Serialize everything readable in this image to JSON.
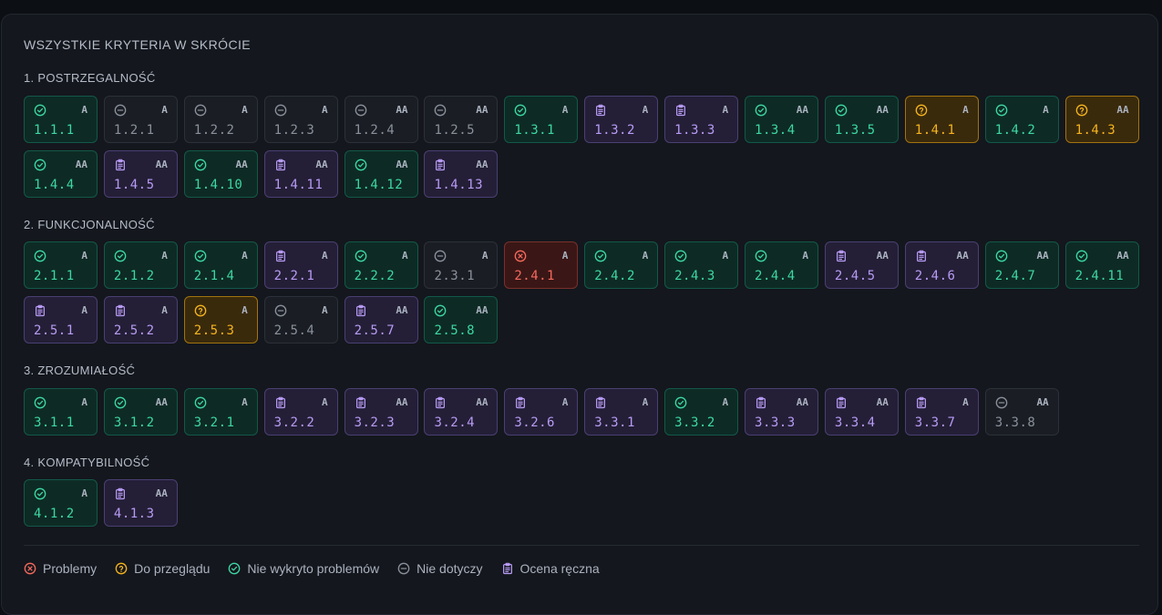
{
  "panel_title": "WSZYSTKIE KRYTERIA W SKRÓCIE",
  "sections": [
    {
      "title": "1. POSTRZEGALNOŚĆ",
      "items": [
        {
          "code": "1.1.1",
          "level": "A",
          "status": "pass"
        },
        {
          "code": "1.2.1",
          "level": "A",
          "status": "na"
        },
        {
          "code": "1.2.2",
          "level": "A",
          "status": "na"
        },
        {
          "code": "1.2.3",
          "level": "A",
          "status": "na"
        },
        {
          "code": "1.2.4",
          "level": "AA",
          "status": "na"
        },
        {
          "code": "1.2.5",
          "level": "AA",
          "status": "na"
        },
        {
          "code": "1.3.1",
          "level": "A",
          "status": "pass"
        },
        {
          "code": "1.3.2",
          "level": "A",
          "status": "manual"
        },
        {
          "code": "1.3.3",
          "level": "A",
          "status": "manual"
        },
        {
          "code": "1.3.4",
          "level": "AA",
          "status": "pass"
        },
        {
          "code": "1.3.5",
          "level": "AA",
          "status": "pass"
        },
        {
          "code": "1.4.1",
          "level": "A",
          "status": "review"
        },
        {
          "code": "1.4.2",
          "level": "A",
          "status": "pass"
        },
        {
          "code": "1.4.3",
          "level": "AA",
          "status": "review"
        },
        {
          "code": "1.4.4",
          "level": "AA",
          "status": "pass"
        },
        {
          "code": "1.4.5",
          "level": "AA",
          "status": "manual"
        },
        {
          "code": "1.4.10",
          "level": "AA",
          "status": "pass"
        },
        {
          "code": "1.4.11",
          "level": "AA",
          "status": "manual"
        },
        {
          "code": "1.4.12",
          "level": "AA",
          "status": "pass"
        },
        {
          "code": "1.4.13",
          "level": "AA",
          "status": "manual"
        }
      ]
    },
    {
      "title": "2. FUNKCJONALNOŚĆ",
      "items": [
        {
          "code": "2.1.1",
          "level": "A",
          "status": "pass"
        },
        {
          "code": "2.1.2",
          "level": "A",
          "status": "pass"
        },
        {
          "code": "2.1.4",
          "level": "A",
          "status": "pass"
        },
        {
          "code": "2.2.1",
          "level": "A",
          "status": "manual"
        },
        {
          "code": "2.2.2",
          "level": "A",
          "status": "pass"
        },
        {
          "code": "2.3.1",
          "level": "A",
          "status": "na"
        },
        {
          "code": "2.4.1",
          "level": "A",
          "status": "fail"
        },
        {
          "code": "2.4.2",
          "level": "A",
          "status": "pass"
        },
        {
          "code": "2.4.3",
          "level": "A",
          "status": "pass"
        },
        {
          "code": "2.4.4",
          "level": "A",
          "status": "pass"
        },
        {
          "code": "2.4.5",
          "level": "AA",
          "status": "manual"
        },
        {
          "code": "2.4.6",
          "level": "AA",
          "status": "manual"
        },
        {
          "code": "2.4.7",
          "level": "AA",
          "status": "pass"
        },
        {
          "code": "2.4.11",
          "level": "AA",
          "status": "pass"
        },
        {
          "code": "2.5.1",
          "level": "A",
          "status": "manual"
        },
        {
          "code": "2.5.2",
          "level": "A",
          "status": "manual"
        },
        {
          "code": "2.5.3",
          "level": "A",
          "status": "review"
        },
        {
          "code": "2.5.4",
          "level": "A",
          "status": "na"
        },
        {
          "code": "2.5.7",
          "level": "AA",
          "status": "manual"
        },
        {
          "code": "2.5.8",
          "level": "AA",
          "status": "pass"
        }
      ]
    },
    {
      "title": "3. ZROZUMIAŁOŚĆ",
      "items": [
        {
          "code": "3.1.1",
          "level": "A",
          "status": "pass"
        },
        {
          "code": "3.1.2",
          "level": "AA",
          "status": "pass"
        },
        {
          "code": "3.2.1",
          "level": "A",
          "status": "pass"
        },
        {
          "code": "3.2.2",
          "level": "A",
          "status": "manual"
        },
        {
          "code": "3.2.3",
          "level": "AA",
          "status": "manual"
        },
        {
          "code": "3.2.4",
          "level": "AA",
          "status": "manual"
        },
        {
          "code": "3.2.6",
          "level": "A",
          "status": "manual"
        },
        {
          "code": "3.3.1",
          "level": "A",
          "status": "manual"
        },
        {
          "code": "3.3.2",
          "level": "A",
          "status": "pass"
        },
        {
          "code": "3.3.3",
          "level": "AA",
          "status": "manual"
        },
        {
          "code": "3.3.4",
          "level": "AA",
          "status": "manual"
        },
        {
          "code": "3.3.7",
          "level": "A",
          "status": "manual"
        },
        {
          "code": "3.3.8",
          "level": "AA",
          "status": "na"
        }
      ]
    },
    {
      "title": "4. KOMPATYBILNOŚĆ",
      "items": [
        {
          "code": "4.1.2",
          "level": "A",
          "status": "pass"
        },
        {
          "code": "4.1.3",
          "level": "AA",
          "status": "manual"
        }
      ]
    }
  ],
  "legend": [
    {
      "status": "fail",
      "label": "Problemy",
      "icon": "x-circle-icon"
    },
    {
      "status": "review",
      "label": "Do przeglądu",
      "icon": "question-circle-icon"
    },
    {
      "status": "pass",
      "label": "Nie wykryto problemów",
      "icon": "check-circle-icon"
    },
    {
      "status": "na",
      "label": "Nie dotyczy",
      "icon": "minus-circle-icon"
    },
    {
      "status": "manual",
      "label": "Ocena ręczna",
      "icon": "clipboard-icon"
    }
  ],
  "colors": {
    "pass": "#3ed7a4",
    "na": "#8a919c",
    "manual": "#b89bf5",
    "review": "#f5b41e",
    "fail": "#f5695e"
  }
}
